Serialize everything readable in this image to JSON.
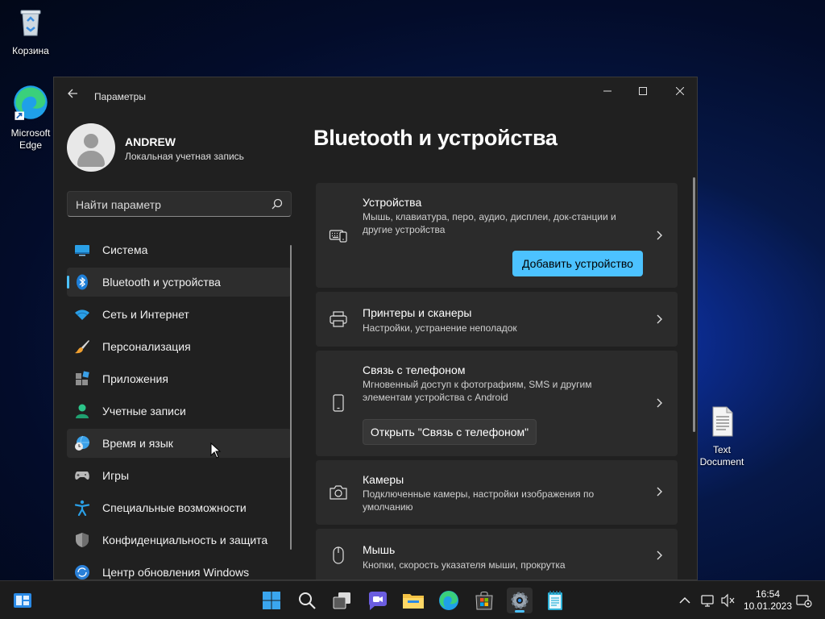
{
  "desktop": {
    "icons": [
      {
        "label": "Корзина"
      },
      {
        "label": "Microsoft Edge"
      },
      {
        "label": "Text Document"
      }
    ]
  },
  "window": {
    "title": "Параметры",
    "profile": {
      "name": "ANDREW",
      "account_type": "Локальная учетная запись"
    },
    "search": {
      "placeholder": "Найти параметр"
    },
    "nav": [
      {
        "label": "Система",
        "icon": "system-icon"
      },
      {
        "label": "Bluetooth и устройства",
        "icon": "bluetooth-icon",
        "active": true
      },
      {
        "label": "Сеть и Интернет",
        "icon": "wifi-icon"
      },
      {
        "label": "Персонализация",
        "icon": "brush-icon"
      },
      {
        "label": "Приложения",
        "icon": "apps-icon"
      },
      {
        "label": "Учетные записи",
        "icon": "account-icon"
      },
      {
        "label": "Время и язык",
        "icon": "time-language-icon"
      },
      {
        "label": "Игры",
        "icon": "gamepad-icon"
      },
      {
        "label": "Специальные возможности",
        "icon": "accessibility-icon"
      },
      {
        "label": "Конфиденциальность и защита",
        "icon": "shield-icon"
      },
      {
        "label": "Центр обновления Windows",
        "icon": "update-icon"
      }
    ],
    "page_title": "Bluetooth и устройства",
    "cards": [
      {
        "title": "Устройства",
        "desc": "Мышь, клавиатура, перо, аудио, дисплеи, док-станции и другие устройства",
        "button": "Добавить устройство"
      },
      {
        "title": "Принтеры и сканеры",
        "desc": "Настройки, устранение неполадок"
      },
      {
        "title": "Связь с телефоном",
        "desc": "Мгновенный доступ к фотографиям, SMS и другим элементам устройства с Android",
        "button": "Открыть \"Связь с телефоном\""
      },
      {
        "title": "Камеры",
        "desc": "Подключенные камеры, настройки изображения по умолчанию"
      },
      {
        "title": "Мышь",
        "desc": "Кнопки, скорость указателя мыши, прокрутка"
      }
    ]
  },
  "taskbar": {
    "time": "16:54",
    "date": "10.01.2023"
  },
  "colors": {
    "accent": "#4cc2ff",
    "window_bg": "#202020",
    "card_bg": "#2b2b2b"
  }
}
